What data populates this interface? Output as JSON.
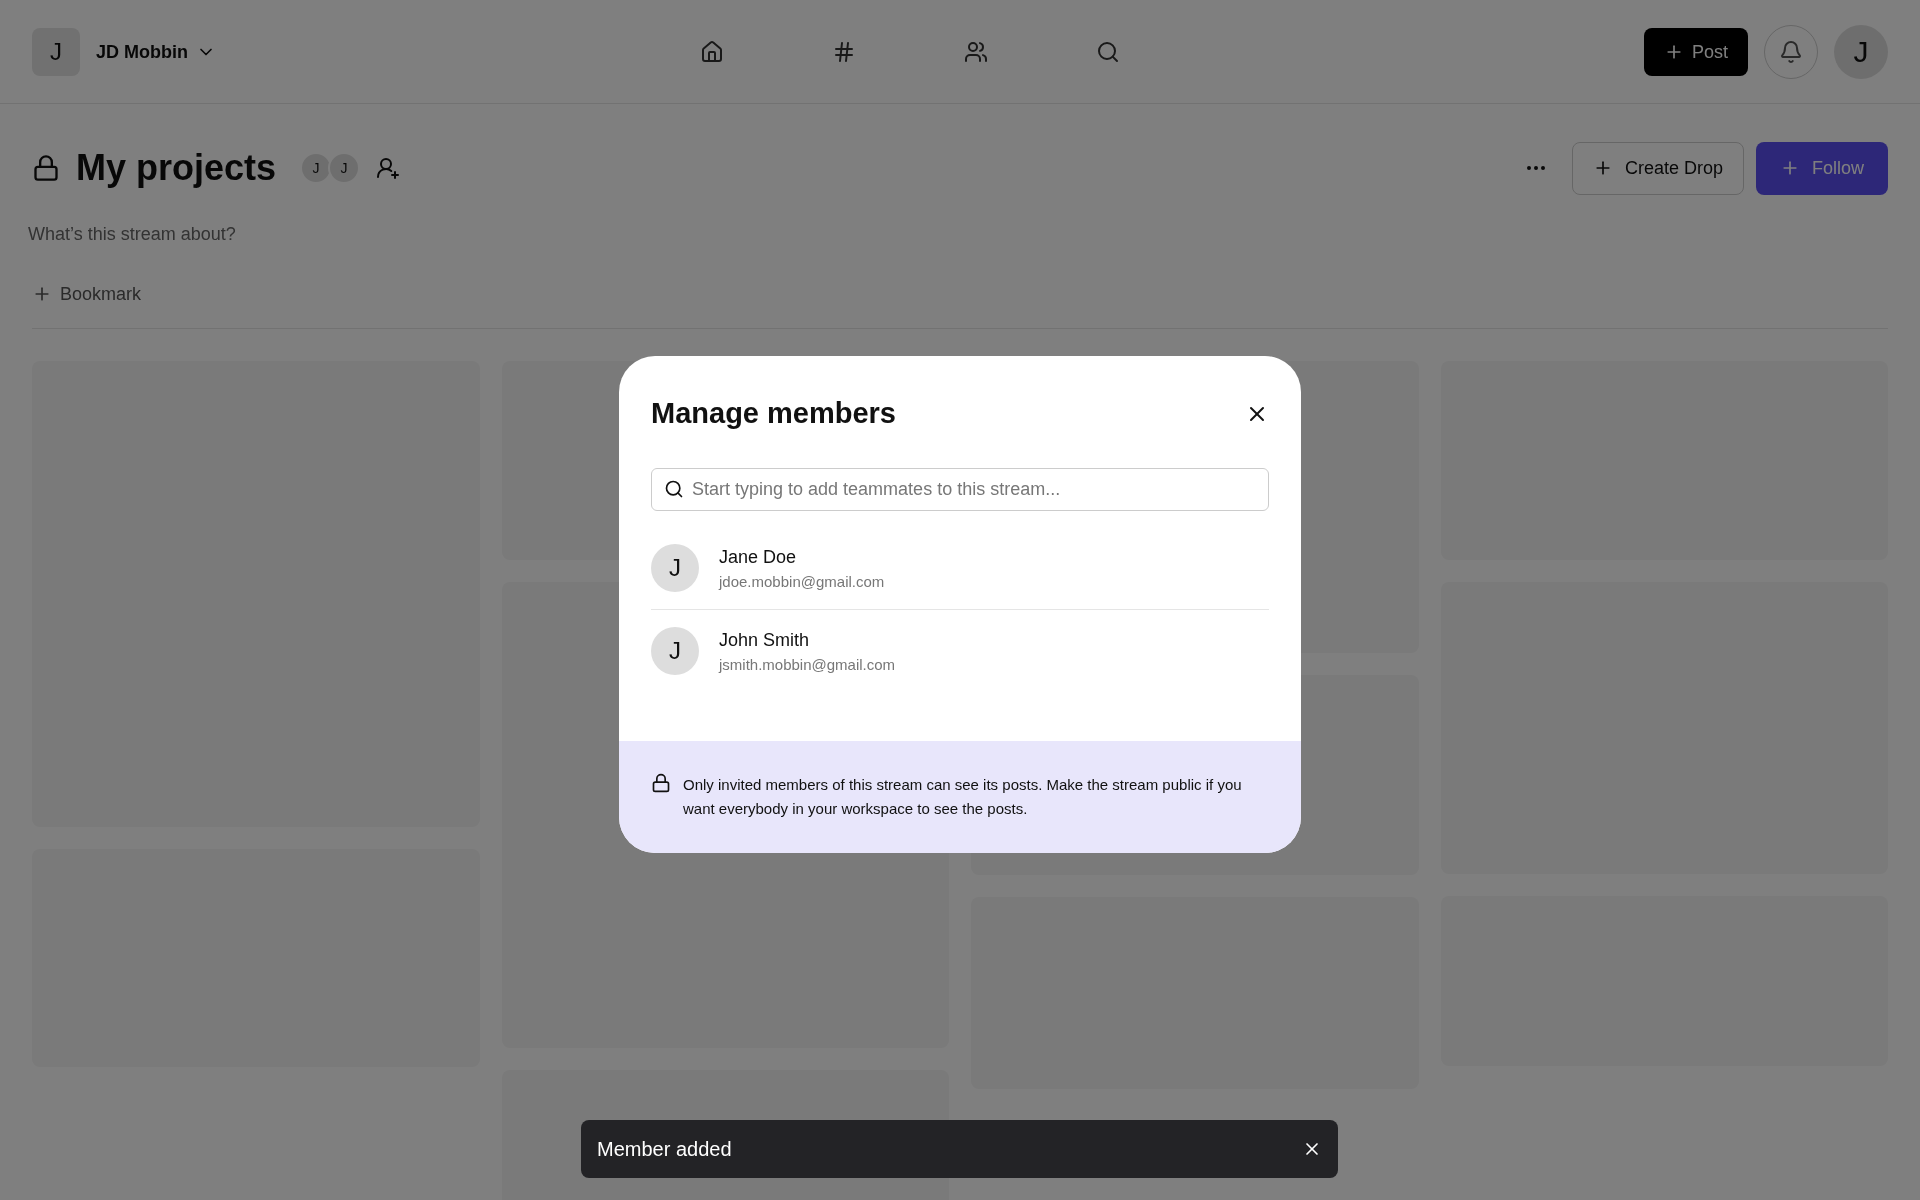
{
  "topbar": {
    "workspace_initial": "J",
    "workspace_name": "JD Mobbin",
    "post_button": "Post",
    "avatar_initial": "J"
  },
  "stream": {
    "title": "My projects",
    "member_initials": [
      "J",
      "J"
    ],
    "description_placeholder": "What’s this stream about?",
    "bookmark": "Bookmark",
    "create_drop": "Create Drop",
    "follow": "Follow"
  },
  "modal": {
    "title": "Manage members",
    "search": {
      "placeholder": "Start typing to add teammates to this stream..."
    },
    "members": [
      {
        "initial": "J",
        "name": "Jane Doe",
        "email": "jdoe.mobbin@gmail.com"
      },
      {
        "initial": "J",
        "name": "John Smith",
        "email": "jsmith.mobbin@gmail.com"
      }
    ],
    "notice": "Only invited members of this stream can see its posts. Make the stream public if you want everybody in your workspace to see the posts."
  },
  "toast": {
    "message": "Member added"
  }
}
